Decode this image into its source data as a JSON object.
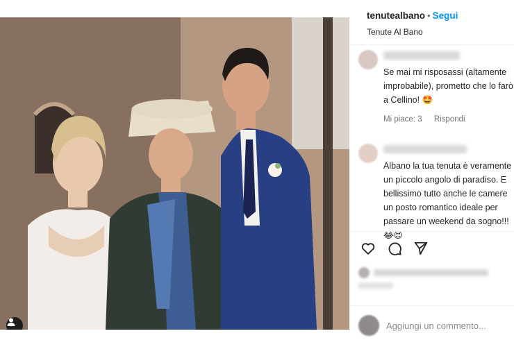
{
  "post": {
    "username": "tenutealbano",
    "separator": "•",
    "follow_label": "Segui",
    "location": "Tenute Al Bano"
  },
  "comments": [
    {
      "text": "Se mai mi risposassi (altamente improbabile), prometto che lo farò a Cellino! 🤩",
      "likes_label": "Mi piace: 3",
      "reply_label": "Rispondi"
    },
    {
      "text": "Albano la tua tenuta è veramente un piccolo angolo di paradiso. E bellissimo tutto anche le camere un posto romantico ideale per passare un weekend da sogno!!! 😂😍"
    }
  ],
  "composer": {
    "placeholder": "Aggiungi un commento..."
  },
  "icons": [
    "heart-icon",
    "comment-icon",
    "share-icon",
    "person-tag-icon"
  ],
  "colors": {
    "follow": "#0095f6",
    "text": "#262626",
    "muted": "#737373"
  }
}
